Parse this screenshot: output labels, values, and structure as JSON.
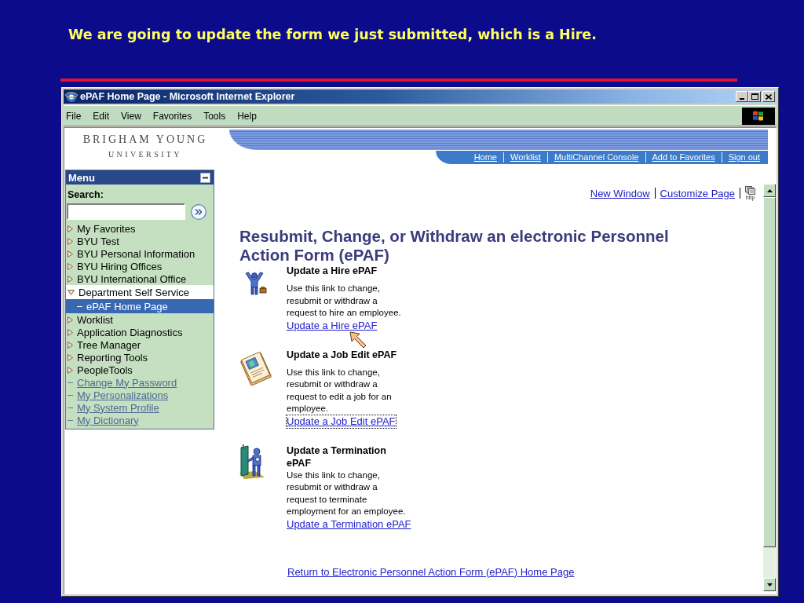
{
  "slide": {
    "caption": "We are going to update the form we just submitted, which is a Hire."
  },
  "window": {
    "title": "ePAF Home Page - Microsoft Internet Explorer"
  },
  "menu_bar": [
    "File",
    "Edit",
    "View",
    "Favorites",
    "Tools",
    "Help"
  ],
  "header": {
    "logo": {
      "line_1": "BRIGHAM YOUNG",
      "line_2": "UNIVERSITY"
    },
    "nav_links": [
      "Home",
      "Worklist",
      "MultiChannel Console",
      "Add to Favorites",
      "Sign out"
    ]
  },
  "sidebar": {
    "title": "Menu",
    "search": {
      "label": "Search:"
    },
    "items": [
      {
        "kind": "folder",
        "label": "My Favorites",
        "expanded": false,
        "selected": false
      },
      {
        "kind": "folder",
        "label": "BYU Test",
        "expanded": false,
        "selected": false
      },
      {
        "kind": "folder",
        "label": "BYU Personal Information",
        "expanded": false,
        "selected": false
      },
      {
        "kind": "folder",
        "label": "BYU Hiring Offices",
        "expanded": false,
        "selected": false
      },
      {
        "kind": "folder",
        "label": "BYU International Office",
        "expanded": false,
        "selected": false
      },
      {
        "kind": "folder",
        "label": "Department Self Service",
        "expanded": true,
        "selected": false,
        "children": [
          {
            "kind": "page",
            "label": "ePAF Home Page",
            "selected": true
          }
        ]
      },
      {
        "kind": "folder",
        "label": "Worklist",
        "expanded": false,
        "selected": false
      },
      {
        "kind": "folder",
        "label": "Application Diagnostics",
        "expanded": false,
        "selected": false
      },
      {
        "kind": "folder",
        "label": "Tree Manager",
        "expanded": false,
        "selected": false
      },
      {
        "kind": "folder",
        "label": "Reporting Tools",
        "expanded": false,
        "selected": false
      },
      {
        "kind": "folder",
        "label": "PeopleTools",
        "expanded": false,
        "selected": false
      },
      {
        "kind": "link",
        "label": "Change My Password",
        "selected": false
      },
      {
        "kind": "link",
        "label": "My Personalizations",
        "selected": false
      },
      {
        "kind": "link",
        "label": "My System Profile",
        "selected": false
      },
      {
        "kind": "link",
        "label": "My Dictionary",
        "selected": false
      }
    ]
  },
  "content": {
    "top_links": [
      "New Window",
      "Customize Page"
    ],
    "http_link": {
      "caption": "http"
    },
    "heading": "Resubmit, Change, or Withdraw an electronic Personnel Action Form (ePAF)",
    "actions": [
      {
        "kind": "hire",
        "title": "Update a Hire ePAF",
        "description": "Use this link to change, resubmit or withdraw a request to hire an employee.",
        "link": {
          "label": "Update a Hire ePAF",
          "focused": false
        }
      },
      {
        "kind": "job_edit",
        "title": "Update a Job Edit ePAF",
        "description": "Use this link to change, resubmit or withdraw a request to edit a job for an employee.",
        "link": {
          "label": "Update a Job Edit ePAF",
          "focused": true
        }
      },
      {
        "kind": "termination",
        "title": "Update a Termination ePAF",
        "description": "Use this link to change, resubmit or withdraw a request to terminate employment for an employee.",
        "link": {
          "label": "Update a Termination ePAF",
          "focused": false
        }
      }
    ],
    "footer_link": "Return to Electronic Personnel Action Form (ePAF) Home Page"
  }
}
